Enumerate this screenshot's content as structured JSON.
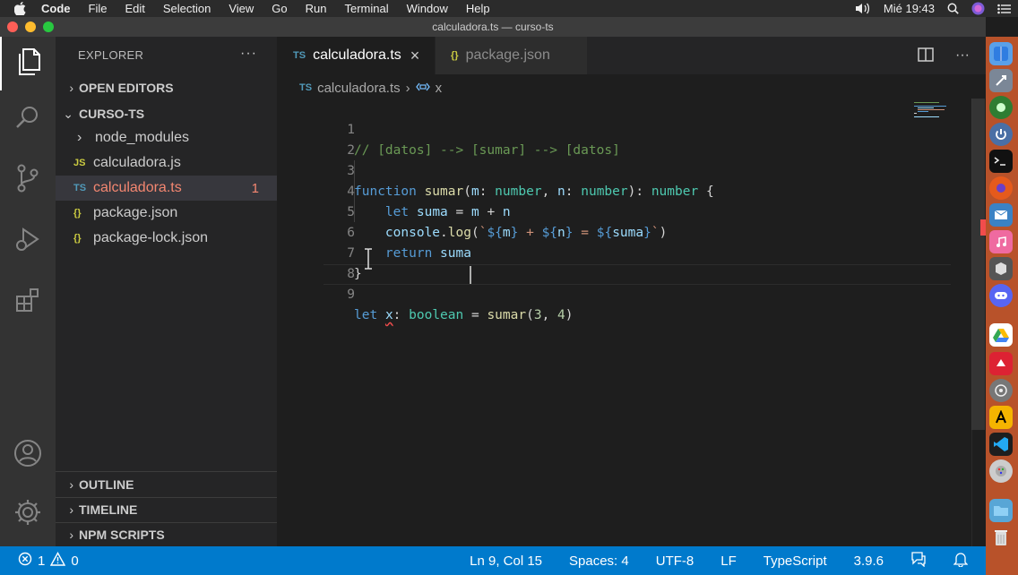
{
  "menubar": {
    "app": "Code",
    "items": [
      "File",
      "Edit",
      "Selection",
      "View",
      "Go",
      "Run",
      "Terminal",
      "Window",
      "Help"
    ],
    "clock": "Mié 19:43"
  },
  "window": {
    "title": "calculadora.ts — curso-ts"
  },
  "sidebar": {
    "title": "EXPLORER",
    "more": "···",
    "open_editors": "OPEN EDITORS",
    "project": "CURSO-TS",
    "files": [
      {
        "label": "node_modules",
        "icon": ""
      },
      {
        "label": "calculadora.js",
        "icon": "JS"
      },
      {
        "label": "calculadora.ts",
        "icon": "TS",
        "badge": "1"
      },
      {
        "label": "package.json",
        "icon": "{}"
      },
      {
        "label": "package-lock.json",
        "icon": "{}"
      }
    ],
    "outline": "OUTLINE",
    "timeline": "TIMELINE",
    "npm_scripts": "NPM SCRIPTS"
  },
  "tabs": [
    {
      "label": "calculadora.ts",
      "icon": "TS",
      "active": true
    },
    {
      "label": "package.json",
      "icon": "{}",
      "active": false
    }
  ],
  "breadcrumb": {
    "file": "calculadora.ts",
    "symbol": "x"
  },
  "code": {
    "line_numbers": [
      "1",
      "2",
      "3",
      "4",
      "5",
      "6",
      "7",
      "8",
      "9"
    ],
    "l1": "// [datos] --> [sumar] --> [datos]",
    "l3_kw": "function",
    "l3_fn": "sumar",
    "l3_p1": "m",
    "l3_p2": "n",
    "l3_type": "number",
    "l4_kw": "let",
    "l4_var": "suma",
    "l4_a": "m",
    "l4_b": "n",
    "l5_obj": "console",
    "l5_fn": "log",
    "l5_m": "m",
    "l5_n": "n",
    "l5_suma": "suma",
    "l6_kw": "return",
    "l6_var": "suma",
    "l7": "}",
    "l9_kw": "let",
    "l9_var": "x",
    "l9_type": "boolean",
    "l9_fn": "sumar",
    "l9_a": "3",
    "l9_b": "4"
  },
  "status": {
    "errors": "1",
    "warnings": "0",
    "position": "Ln 9, Col 15",
    "spaces": "Spaces: 4",
    "encoding": "UTF-8",
    "eol": "LF",
    "language": "TypeScript",
    "version": "3.9.6"
  },
  "colors": {
    "accent": "#007acc",
    "error": "#f48771",
    "dock": "#b8522a"
  }
}
